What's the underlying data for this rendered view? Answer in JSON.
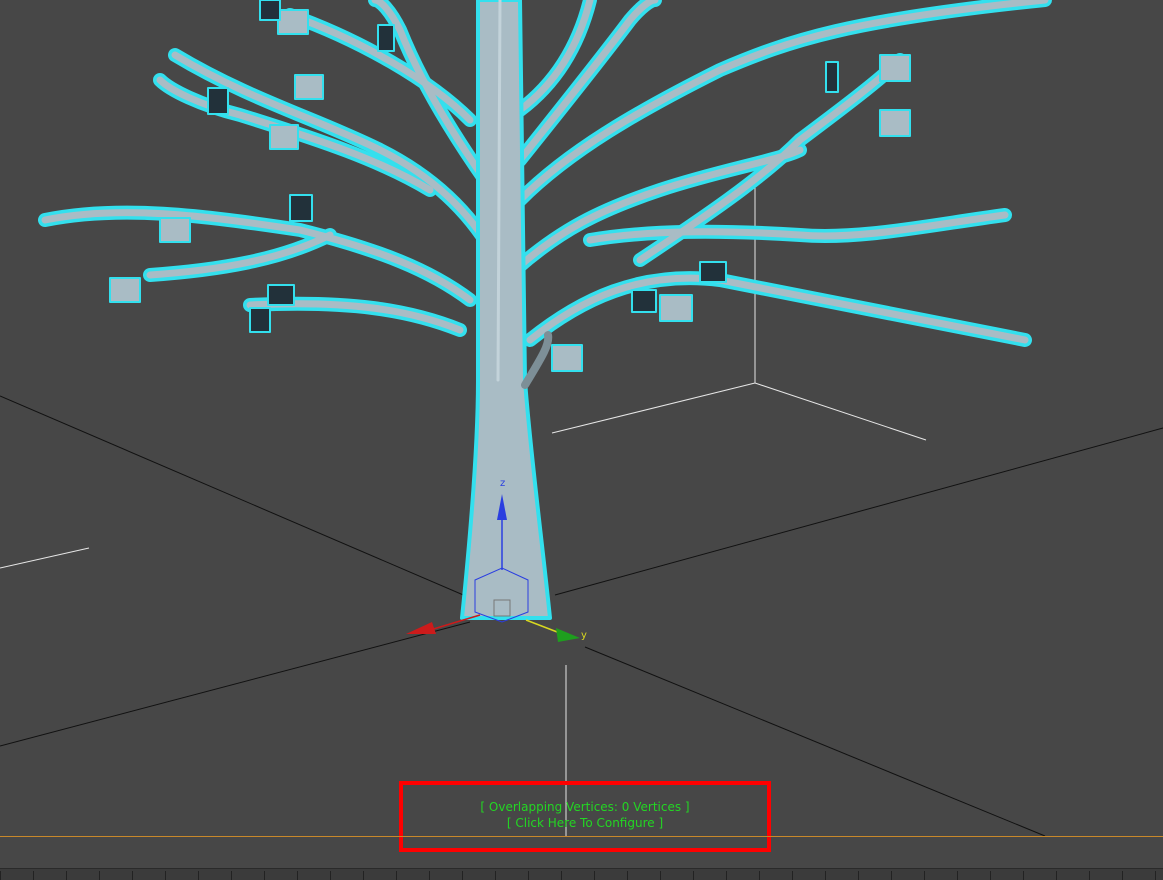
{
  "viewport": {
    "background_color": "#474747",
    "selection_highlight_color": "#33e0ee",
    "object_color": "#a9bcc5"
  },
  "gizmo": {
    "z_label": "z",
    "y_label": "y",
    "x_color": "#cc1b1b",
    "y_color": "#1e9e1e",
    "z_color": "#2a3ee0"
  },
  "overlay": {
    "overlapping_vertices": "[ Overlapping Vertices: 0 Vertices ]",
    "configure_link": "[ Click Here To Configure ]",
    "text_color": "#23d623",
    "frame_color": "#ff0000"
  },
  "timeline": {
    "indicator_color": "#c8882a"
  }
}
